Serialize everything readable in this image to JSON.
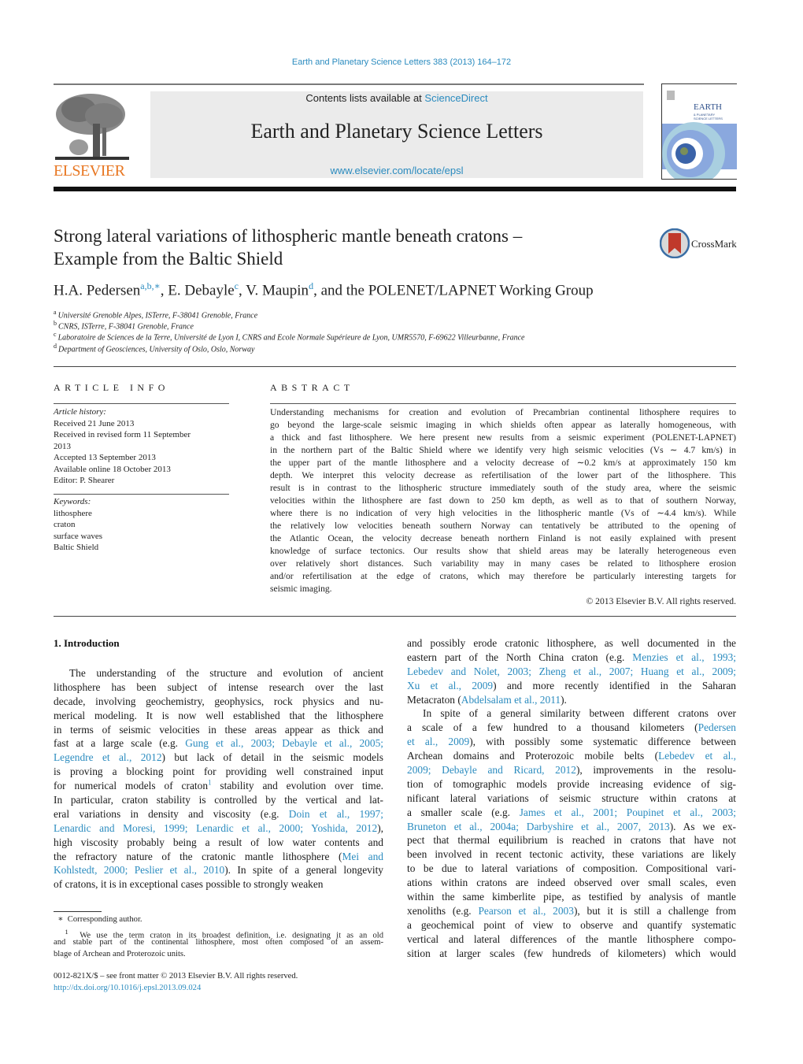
{
  "header": {
    "journal_reference": "Earth and Planetary Science Letters 383 (2013) 164–172",
    "contents_prefix": "Contents lists available at ",
    "contents_link": "ScienceDirect",
    "journal_title": "Earth and Planetary Science Letters",
    "journal_url": "www.elsevier.com/locate/epsl",
    "publisher_logo": "ELSEVIER",
    "cover_title_line1": "EARTH",
    "cover_title_line2": "& PLANETARY",
    "cover_title_line3": "SCIENCE LETTERS",
    "colors": {
      "link": "#2a8bbf",
      "elsevier_orange": "#e87722",
      "banner_bg": "#ebebeb"
    }
  },
  "article": {
    "title_line1": "Strong lateral variations of lithospheric mantle beneath cratons –",
    "title_line2": "Example from the Baltic Shield",
    "crossmark_label": "CrossMark",
    "authors": [
      {
        "name": "H.A. Pedersen",
        "marks": "a,b,∗",
        "sep": ", "
      },
      {
        "name": "E. Debayle",
        "marks": "c",
        "sep": ", "
      },
      {
        "name": "V. Maupin",
        "marks": "d",
        "sep": ", and the POLENET/LAPNET Working Group"
      }
    ],
    "affiliations": [
      {
        "key": "a",
        "text": "Université Grenoble Alpes, ISTerre, F-38041 Grenoble, France"
      },
      {
        "key": "b",
        "text": "CNRS, ISTerre, F-38041 Grenoble, France"
      },
      {
        "key": "c",
        "text": "Laboratoire de Sciences de la Terre, Université de Lyon I, CNRS and Ecole Normale Supérieure de Lyon, UMR5570, F-69622 Villeurbanne, France"
      },
      {
        "key": "d",
        "text": "Department of Geosciences, University of Oslo, Oslo, Norway"
      }
    ]
  },
  "article_info": {
    "heading": "ARTICLE INFO",
    "history_label": "Article history:",
    "history": [
      "Received 21 June 2013",
      "Received in revised form 11 September",
      "2013",
      "Accepted 13 September 2013",
      "Available online 18 October 2013",
      "Editor: P. Shearer"
    ],
    "keywords_label": "Keywords:",
    "keywords": [
      "lithosphere",
      "craton",
      "surface waves",
      "Baltic Shield"
    ]
  },
  "abstract": {
    "heading": "ABSTRACT",
    "lines": [
      "Understanding mechanisms for creation and evolution of Precambrian continental lithosphere requires to",
      "go beyond the large-scale seismic imaging in which shields often appear as laterally homogeneous, with",
      "a thick and fast lithosphere. We here present new results from a seismic experiment (POLENET-LAPNET)",
      "in the northern part of the Baltic Shield where we identify very high seismic velocities (Vs ∼ 4.7 km/s) in",
      "the upper part of the mantle lithosphere and a velocity decrease of ∼0.2 km/s at approximately 150 km",
      "depth. We interpret this velocity decrease as refertilisation of the lower part of the lithosphere. This",
      "result is in contrast to the lithospheric structure immediately south of the study area, where the seismic",
      "velocities within the lithosphere are fast down to 250 km depth, as well as to that of southern Norway,",
      "where there is no indication of very high velocities in the lithospheric mantle (Vs of ∼4.4 km/s). While",
      "the relatively low velocities beneath southern Norway can tentatively be attributed to the opening of",
      "the Atlantic Ocean, the velocity decrease beneath northern Finland is not easily explained with present",
      "knowledge of surface tectonics. Our results show that shield areas may be laterally heterogeneous even",
      "over relatively short distances. Such variability may in many cases be related to lithosphere erosion",
      "and/or refertilisation at the edge of cratons, which may therefore be particularly interesting targets for",
      "seismic imaging."
    ],
    "copyright": "© 2013 Elsevier B.V. All rights reserved."
  },
  "introduction": {
    "heading": "1. Introduction",
    "left_lines": [
      [
        {
          "t": "The understanding of the structure and evolution of ancient"
        }
      ],
      [
        {
          "t": "lithosphere has been subject of intense research over the last"
        }
      ],
      [
        {
          "t": "decade, involving geochemistry, geophysics, rock physics and nu-"
        }
      ],
      [
        {
          "t": "merical modeling. It is now well established that the lithosphere"
        }
      ],
      [
        {
          "t": "in terms of seismic velocities in these areas appear as thick and"
        }
      ],
      [
        {
          "t": "fast at a large scale (e.g. "
        },
        {
          "t": "Gung et al., 2003; Debayle et al., 2005;",
          "link": true
        }
      ],
      [
        {
          "t": "Legendre et al., 2012",
          "link": true
        },
        {
          "t": ") but lack of detail in the seismic models"
        }
      ],
      [
        {
          "t": "is proving a blocking point for providing well constrained input"
        }
      ],
      [
        {
          "t": "for numerical models of craton"
        },
        {
          "t": "1",
          "sup": true
        },
        {
          "t": " stability and evolution over time."
        }
      ],
      [
        {
          "t": "In particular, craton stability is controlled by the vertical and lat-"
        }
      ],
      [
        {
          "t": "eral variations in density and viscosity (e.g. "
        },
        {
          "t": "Doin et al., 1997;",
          "link": true
        }
      ],
      [
        {
          "t": "Lenardic and Moresi, 1999; Lenardic et al., 2000; Yoshida, 2012",
          "link": true
        },
        {
          "t": "),"
        }
      ],
      [
        {
          "t": "high viscosity probably being a result of low water contents and"
        }
      ],
      [
        {
          "t": "the refractory nature of the cratonic mantle lithosphere ("
        },
        {
          "t": "Mei and",
          "link": true
        }
      ],
      [
        {
          "t": "Kohlstedt, 2000; Peslier et al., 2010",
          "link": true
        },
        {
          "t": "). In spite of a general longevity"
        }
      ],
      [
        {
          "t": "of cratons, it is in exceptional cases possible to strongly weaken"
        }
      ]
    ],
    "right_lines": [
      [
        {
          "t": "and possibly erode cratonic lithosphere, as well documented in the"
        }
      ],
      [
        {
          "t": "eastern part of the North China craton (e.g. "
        },
        {
          "t": "Menzies et al., 1993;",
          "link": true
        }
      ],
      [
        {
          "t": "Lebedev and Nolet, 2003; Zheng et al., 2007; Huang et al., 2009;",
          "link": true
        }
      ],
      [
        {
          "t": "Xu et al., 2009",
          "link": true
        },
        {
          "t": ") and more recently identified in the Saharan"
        }
      ],
      [
        {
          "t": "Metacraton ("
        },
        {
          "t": "Abdelsalam et al., 2011",
          "link": true
        },
        {
          "t": ")."
        }
      ],
      [
        {
          "t": "In spite of a general similarity between different cratons over"
        }
      ],
      [
        {
          "t": "a scale of a few hundred to a thousand kilometers ("
        },
        {
          "t": "Pedersen",
          "link": true
        }
      ],
      [
        {
          "t": "et al., 2009",
          "link": true
        },
        {
          "t": "), with possibly some systematic difference between"
        }
      ],
      [
        {
          "t": "Archean domains and Proterozoic mobile belts ("
        },
        {
          "t": "Lebedev et al.,",
          "link": true
        }
      ],
      [
        {
          "t": "2009; Debayle and Ricard, 2012",
          "link": true
        },
        {
          "t": "), improvements in the resolu-"
        }
      ],
      [
        {
          "t": "tion of tomographic models provide increasing evidence of sig-"
        }
      ],
      [
        {
          "t": "nificant lateral variations of seismic structure within cratons at"
        }
      ],
      [
        {
          "t": "a smaller scale (e.g. "
        },
        {
          "t": "James et al., 2001; Poupinet et al., 2003;",
          "link": true
        }
      ],
      [
        {
          "t": "Bruneton et al., 2004a; Darbyshire et al., 2007, 2013",
          "link": true
        },
        {
          "t": "). As we ex-"
        }
      ],
      [
        {
          "t": "pect that thermal equilibrium is reached in cratons that have not"
        }
      ],
      [
        {
          "t": "been involved in recent tectonic activity, these variations are likely"
        }
      ],
      [
        {
          "t": "to be due to lateral variations of composition. Compositional vari-"
        }
      ],
      [
        {
          "t": "ations within cratons are indeed observed over small scales, even"
        }
      ],
      [
        {
          "t": "within the same kimberlite pipe, as testified by analysis of mantle"
        }
      ],
      [
        {
          "t": "xenoliths (e.g. "
        },
        {
          "t": "Pearson et al., 2003",
          "link": true
        },
        {
          "t": "), but it is still a challenge from"
        }
      ],
      [
        {
          "t": "a geochemical point of view to observe and quantify systematic"
        }
      ],
      [
        {
          "t": "vertical and lateral differences of the mantle lithosphere compo-"
        }
      ],
      [
        {
          "t": "sition at larger scales (few hundreds of kilometers) which would"
        }
      ]
    ]
  },
  "footnotes": {
    "corresponding_mark": "∗",
    "corresponding_text": "Corresponding author.",
    "fn1_mark": "1",
    "fn1_lines": [
      "We use the term craton in its broadest definition, i.e. designating it as an old",
      "and stable part of the continental lithosphere, most often composed of an assem-",
      "blage of Archean and Proterozoic units."
    ]
  },
  "footer": {
    "issn_line": "0012-821X/$ – see front matter  © 2013 Elsevier B.V. All rights reserved.",
    "doi_link": "http://dx.doi.org/10.1016/j.epsl.2013.09.024"
  }
}
